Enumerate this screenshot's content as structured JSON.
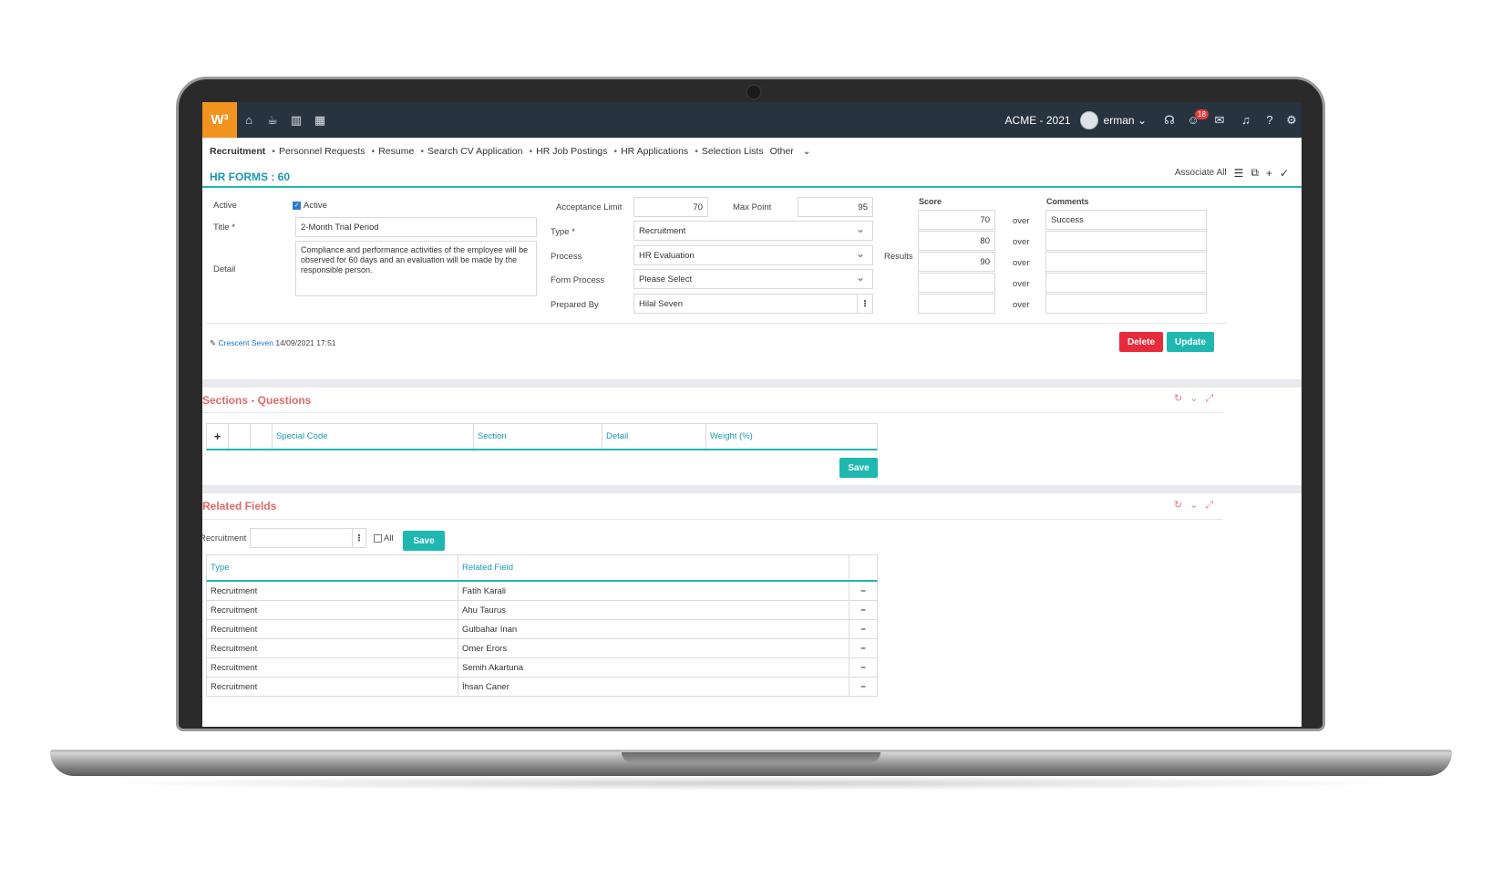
{
  "app": {
    "logo_text": "W³",
    "company": "ACME - 2021",
    "user": "erman",
    "notification_count": "18"
  },
  "menu": {
    "items": [
      "Recruitment",
      "Personnel Requests",
      "Resume",
      "Search CV Application",
      "HR Job Postings",
      "HR Applications",
      "Selection Lists"
    ],
    "other_label": "Other"
  },
  "header": {
    "title": "HR FORMS : 60",
    "associate_all": "Associate All"
  },
  "form": {
    "active_label": "Active",
    "active_checkbox_label": "Active",
    "title_label": "Title *",
    "title_value": "2-Month Trial Period",
    "detail_label": "Detail",
    "detail_value": "Compliance and performance activities of the employee will be observed for 60 days and an evaluation will be made by the responsible person.",
    "acceptance_limit_label": "Acceptance Limit",
    "acceptance_limit_value": "70",
    "max_point_label": "Max Point",
    "max_point_value": "95",
    "type_label": "Type *",
    "type_value": "Recruitment",
    "process_label": "Process",
    "process_value": "HR Evaluation",
    "form_process_label": "Form Process",
    "form_process_value": "Please Select",
    "prepared_by_label": "Prepared By",
    "prepared_by_value": "Hilal Seven",
    "results_label": "Results",
    "score_header": "Score",
    "comments_header": "Comments",
    "over_label": "over",
    "scores": [
      "70",
      "80",
      "90",
      "",
      ""
    ],
    "comments": [
      "Success",
      "",
      "",
      "",
      ""
    ]
  },
  "audit": {
    "user": "Crescent Seven",
    "timestamp": "14/09/2021 17:51"
  },
  "actions": {
    "delete": "Delete",
    "update": "Update"
  },
  "sections": {
    "title": "Sections - Questions",
    "add_symbol": "+",
    "columns": [
      "Special Code",
      "Section",
      "Detail",
      "Weight (%)"
    ],
    "save": "Save"
  },
  "related": {
    "title": "Related Fields",
    "filter_label": "Recruitment",
    "all_label": "All",
    "save": "Save",
    "columns": [
      "Type",
      "Related Field"
    ],
    "rows": [
      {
        "type": "Recruitment",
        "field": "Fatih Karali"
      },
      {
        "type": "Recruitment",
        "field": "Ahu Taurus"
      },
      {
        "type": "Recruitment",
        "field": "Gulbahar Inan"
      },
      {
        "type": "Recruitment",
        "field": "Omer Erors"
      },
      {
        "type": "Recruitment",
        "field": "Semih Akartuna"
      },
      {
        "type": "Recruitment",
        "field": "İhsan Caner"
      }
    ],
    "remove_symbol": "−"
  }
}
